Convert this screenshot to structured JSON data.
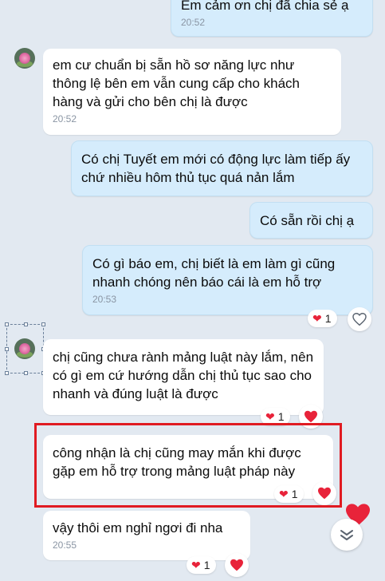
{
  "messages": [
    {
      "id": "m0",
      "side": "out",
      "text": "Em cảm ơn chị đã chia sẻ ạ",
      "time": "20:52"
    },
    {
      "id": "m1",
      "side": "in",
      "text": "em cư chuẩn bị sẵn hồ sơ năng lực như thông lệ bên em vẫn cung cấp cho khách hàng và gửi cho bên chị là được",
      "time": "20:52"
    },
    {
      "id": "m2",
      "side": "out",
      "text": "Có chị Tuyết em mới có động lực làm tiếp ấy chứ nhiều hôm thủ tục quá nản lắm"
    },
    {
      "id": "m3",
      "side": "out",
      "text": "Có sẵn rồi chị ạ"
    },
    {
      "id": "m4",
      "side": "out",
      "text": "Có gì báo em, chị biết là em làm gì cũng nhanh chóng nên báo cái là em hỗ trợ",
      "time": "20:53",
      "reaction_count": "1"
    },
    {
      "id": "m5",
      "side": "in",
      "text": "chị cũng chưa rành mảng luật này lắm, nên có gì em cứ hướng dẫn chị thủ tục sao cho nhanh và đúng luật là được",
      "reaction_count": "1"
    },
    {
      "id": "m6",
      "side": "in",
      "text": "công nhận là chị cũng may mắn khi được gặp em hỗ trợ trong mảng luật pháp này",
      "reaction_count": "1",
      "highlighted": true
    },
    {
      "id": "m7",
      "side": "in",
      "text": "vậy thôi em nghỉ ngơi đi nha",
      "time": "20:55",
      "reaction_count": "1"
    }
  ],
  "icons": {
    "heart": "heart-icon",
    "heart_outline": "heart-outline-icon",
    "scroll_down": "chevron-down-icon",
    "avatar": "lotus-avatar"
  },
  "colors": {
    "background": "#e2e9f1",
    "outgoing_bubble": "#d5ecfc",
    "incoming_bubble": "#ffffff",
    "heart": "#e8233a",
    "highlight_border": "#e01b22"
  }
}
